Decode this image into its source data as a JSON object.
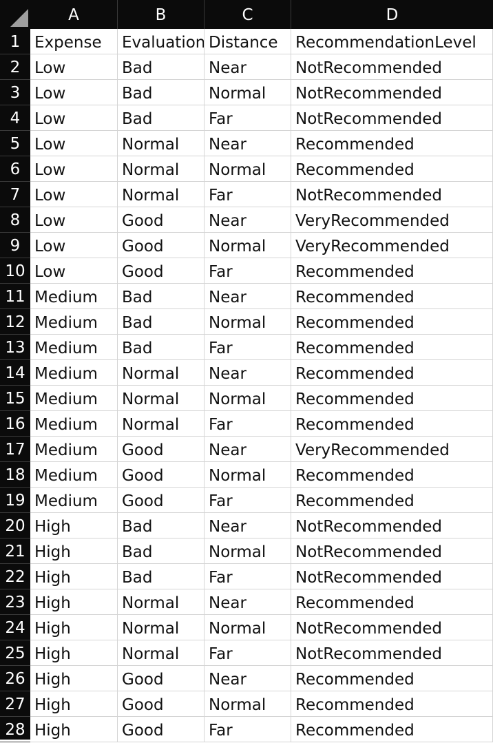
{
  "columns": [
    "A",
    "B",
    "C",
    "D"
  ],
  "rows": [
    {
      "num": "1",
      "cells": [
        "Expense",
        "Evaluation",
        "Distance",
        "RecommendationLevel"
      ]
    },
    {
      "num": "2",
      "cells": [
        "Low",
        "Bad",
        "Near",
        "NotRecommended"
      ]
    },
    {
      "num": "3",
      "cells": [
        "Low",
        "Bad",
        "Normal",
        "NotRecommended"
      ]
    },
    {
      "num": "4",
      "cells": [
        "Low",
        "Bad",
        "Far",
        "NotRecommended"
      ]
    },
    {
      "num": "5",
      "cells": [
        "Low",
        "Normal",
        "Near",
        "Recommended"
      ]
    },
    {
      "num": "6",
      "cells": [
        "Low",
        "Normal",
        "Normal",
        "Recommended"
      ]
    },
    {
      "num": "7",
      "cells": [
        "Low",
        "Normal",
        "Far",
        "NotRecommended"
      ]
    },
    {
      "num": "8",
      "cells": [
        "Low",
        "Good",
        "Near",
        "VeryRecommended"
      ]
    },
    {
      "num": "9",
      "cells": [
        "Low",
        "Good",
        "Normal",
        "VeryRecommended"
      ]
    },
    {
      "num": "10",
      "cells": [
        "Low",
        "Good",
        "Far",
        "Recommended"
      ]
    },
    {
      "num": "11",
      "cells": [
        "Medium",
        "Bad",
        "Near",
        "Recommended"
      ]
    },
    {
      "num": "12",
      "cells": [
        "Medium",
        "Bad",
        "Normal",
        "Recommended"
      ]
    },
    {
      "num": "13",
      "cells": [
        "Medium",
        "Bad",
        "Far",
        "Recommended"
      ]
    },
    {
      "num": "14",
      "cells": [
        "Medium",
        "Normal",
        "Near",
        "Recommended"
      ]
    },
    {
      "num": "15",
      "cells": [
        "Medium",
        "Normal",
        "Normal",
        "Recommended"
      ]
    },
    {
      "num": "16",
      "cells": [
        "Medium",
        "Normal",
        "Far",
        "Recommended"
      ]
    },
    {
      "num": "17",
      "cells": [
        "Medium",
        "Good",
        "Near",
        "VeryRecommended"
      ]
    },
    {
      "num": "18",
      "cells": [
        "Medium",
        "Good",
        "Normal",
        "Recommended"
      ]
    },
    {
      "num": "19",
      "cells": [
        "Medium",
        "Good",
        "Far",
        "Recommended"
      ]
    },
    {
      "num": "20",
      "cells": [
        "High",
        "Bad",
        "Near",
        "NotRecommended"
      ]
    },
    {
      "num": "21",
      "cells": [
        "High",
        "Bad",
        "Normal",
        "NotRecommended"
      ]
    },
    {
      "num": "22",
      "cells": [
        "High",
        "Bad",
        "Far",
        "NotRecommended"
      ]
    },
    {
      "num": "23",
      "cells": [
        "High",
        "Normal",
        "Near",
        "Recommended"
      ]
    },
    {
      "num": "24",
      "cells": [
        "High",
        "Normal",
        "Normal",
        "NotRecommended"
      ]
    },
    {
      "num": "25",
      "cells": [
        "High",
        "Normal",
        "Far",
        "NotRecommended"
      ]
    },
    {
      "num": "26",
      "cells": [
        "High",
        "Good",
        "Near",
        "Recommended"
      ]
    },
    {
      "num": "27",
      "cells": [
        "High",
        "Good",
        "Normal",
        "Recommended"
      ]
    },
    {
      "num": "28",
      "cells": [
        "High",
        "Good",
        "Far",
        "Recommended"
      ]
    }
  ]
}
